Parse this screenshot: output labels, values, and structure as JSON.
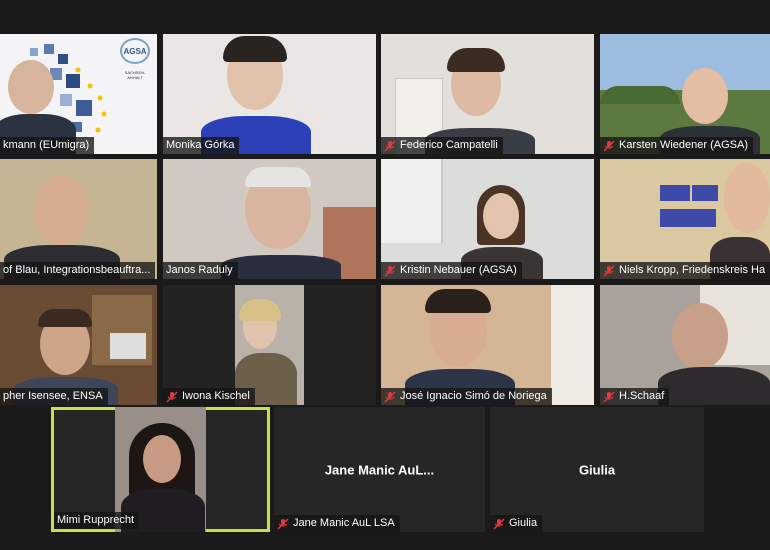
{
  "colors": {
    "background": "#1a1a1a",
    "active_speaker_border": "#c8e048",
    "mute_icon": "#e0383e"
  },
  "participants": [
    {
      "name": "kmann (EUmigra)",
      "muted": false
    },
    {
      "name": "Monika Górka",
      "muted": false
    },
    {
      "name": "Federico Campatelli",
      "muted": true
    },
    {
      "name": "Karsten Wiedener (AGSA)",
      "muted": true
    },
    {
      "name": "of Blau, Integrationsbeauftra...",
      "muted": false
    },
    {
      "name": "Janos Raduly",
      "muted": false
    },
    {
      "name": "Kristin Nebauer (AGSA)",
      "muted": true
    },
    {
      "name": "Niels Kropp, Friedenskreis Ha",
      "muted": true
    },
    {
      "name": "pher Isensee, ENSA",
      "muted": false
    },
    {
      "name": "Iwona Kischel",
      "muted": true
    },
    {
      "name": "José Ignacio Simó de Noriega",
      "muted": true
    },
    {
      "name": "H.Schaaf",
      "muted": true
    },
    {
      "name": "Mimi Rupprecht",
      "muted": false,
      "active": true
    },
    {
      "name": "Jane Manic AuL LSA",
      "display_title": "Jane Manic AuL...",
      "muted": true
    },
    {
      "name": "Giulia",
      "display_title": "Giulia",
      "muted": true
    }
  ],
  "logo": {
    "text": "AGSA",
    "subtext": "SACHSEN-ANHALT"
  }
}
